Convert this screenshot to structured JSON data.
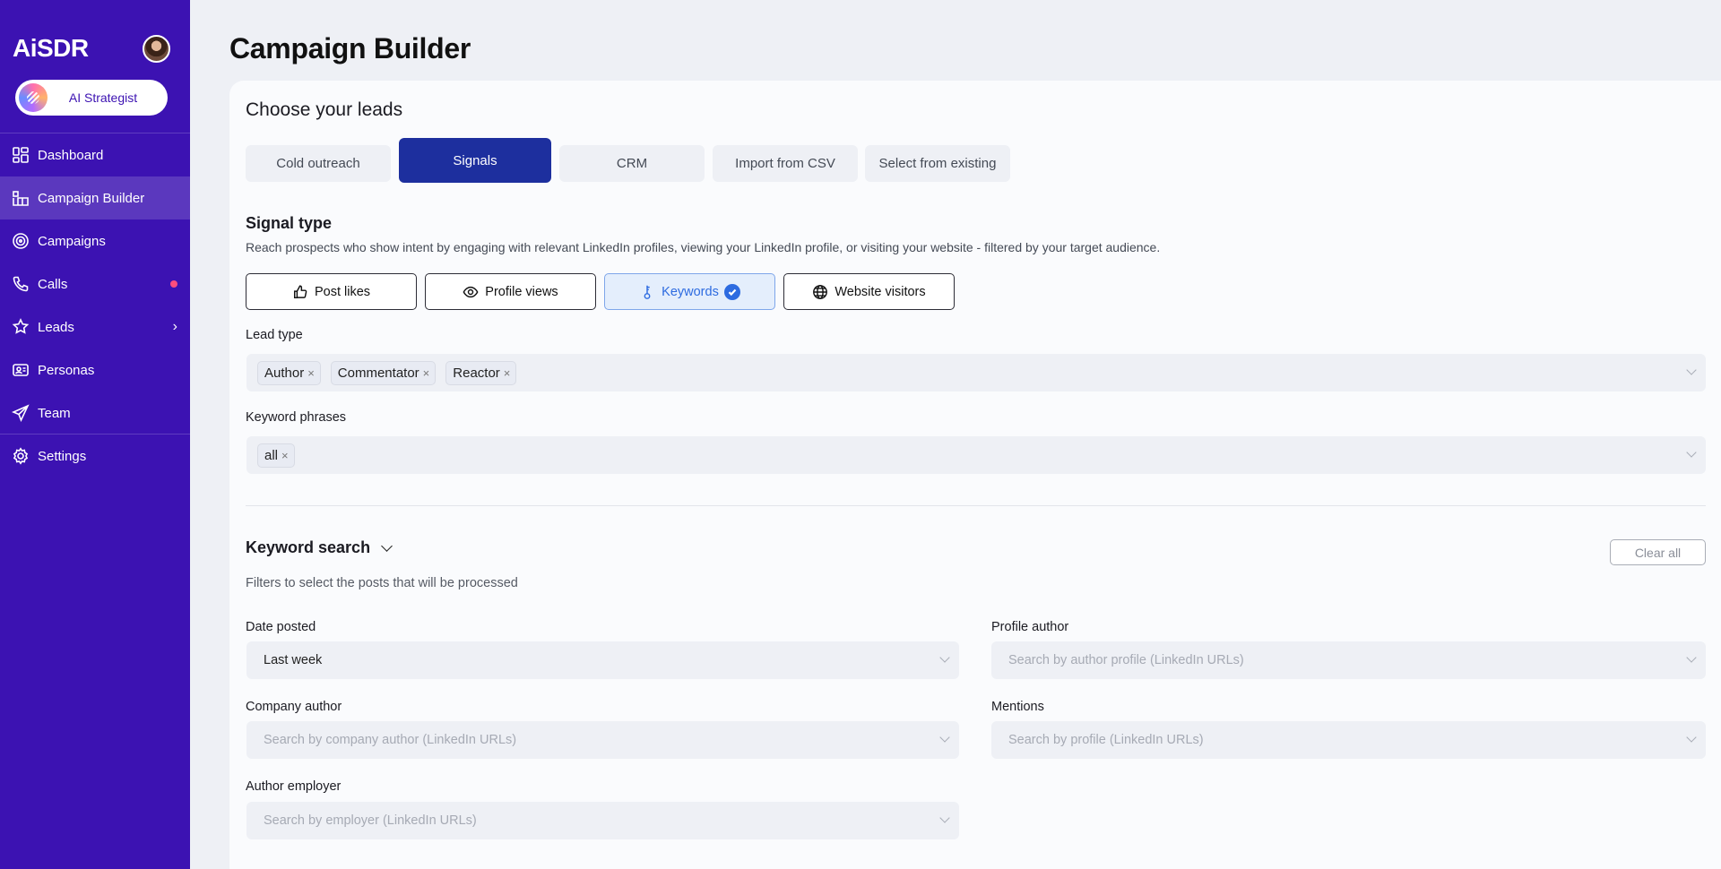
{
  "sidebar": {
    "brand": "AiSDR",
    "strategist_label": "AI Strategist",
    "items": [
      {
        "label": "Dashboard",
        "icon": "dashboard-icon"
      },
      {
        "label": "Campaign Builder",
        "icon": "campaign-builder-icon",
        "active": true
      },
      {
        "label": "Campaigns",
        "icon": "target-icon"
      },
      {
        "label": "Calls",
        "icon": "phone-icon",
        "badge": "red-dot"
      },
      {
        "label": "Leads",
        "icon": "star-person-icon",
        "chevron": "›"
      },
      {
        "label": "Personas",
        "icon": "persona-card-icon"
      },
      {
        "label": "Team",
        "icon": "send-icon"
      },
      {
        "label": "Settings",
        "icon": "gear-icon"
      }
    ],
    "accent_color": "#3c12b2"
  },
  "page": {
    "title": "Campaign Builder"
  },
  "leads": {
    "heading": "Choose your leads",
    "tabs": [
      {
        "label": "Cold outreach"
      },
      {
        "label": "Signals",
        "active": true
      },
      {
        "label": "CRM"
      },
      {
        "label": "Import from CSV"
      },
      {
        "label": "Select from existing"
      }
    ]
  },
  "signal": {
    "heading": "Signal type",
    "description": "Reach prospects who show intent by engaging with relevant LinkedIn profiles, viewing your LinkedIn profile, or visiting your website - filtered by your target audience.",
    "types": [
      {
        "label": "Post likes",
        "icon": "thumbs-up-icon"
      },
      {
        "label": "Profile views",
        "icon": "eye-icon"
      },
      {
        "label": "Keywords",
        "icon": "key-icon",
        "active": true
      },
      {
        "label": "Website visitors",
        "icon": "globe-icon"
      }
    ],
    "lead_type_label": "Lead type",
    "lead_types": [
      "Author",
      "Commentator",
      "Reactor"
    ],
    "keyword_phrases_label": "Keyword phrases",
    "keyword_phrases": [
      "all"
    ]
  },
  "keyword_search": {
    "heading": "Keyword search",
    "clear_label": "Clear all",
    "description": "Filters to select the posts that will be processed",
    "date_posted_label": "Date posted",
    "date_posted_value": "Last week",
    "profile_author_label": "Profile author",
    "profile_author_placeholder": "Search by author profile (LinkedIn URLs)",
    "company_author_label": "Company author",
    "company_author_placeholder": "Search by company author (LinkedIn URLs)",
    "mentions_label": "Mentions",
    "mentions_placeholder": "Search by profile (LinkedIn URLs)",
    "author_employer_label": "Author employer",
    "author_employer_placeholder": "Search by employer (LinkedIn URLs)"
  }
}
